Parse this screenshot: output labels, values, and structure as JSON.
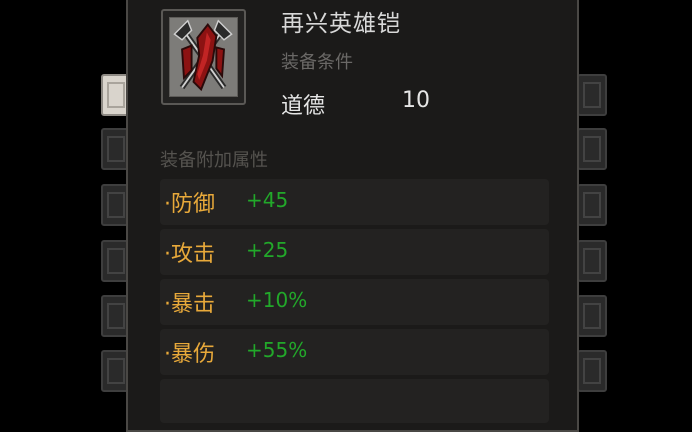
{
  "item": {
    "name": "再兴英雄铠",
    "icon": "red-armor-icon"
  },
  "requirements": {
    "title": "装备条件",
    "label": "道德",
    "value": "10"
  },
  "attributes": {
    "title": "装备附加属性",
    "rows": [
      {
        "name": "·防御",
        "value": "+45"
      },
      {
        "name": "·攻击",
        "value": "+25"
      },
      {
        "name": "·暴击",
        "value": "+10%"
      },
      {
        "name": "·暴伤",
        "value": "+55%"
      }
    ]
  },
  "colors": {
    "attribute_name": "#e8a93a",
    "attribute_value": "#22a82a",
    "panel_bg": "#1b1a19"
  }
}
